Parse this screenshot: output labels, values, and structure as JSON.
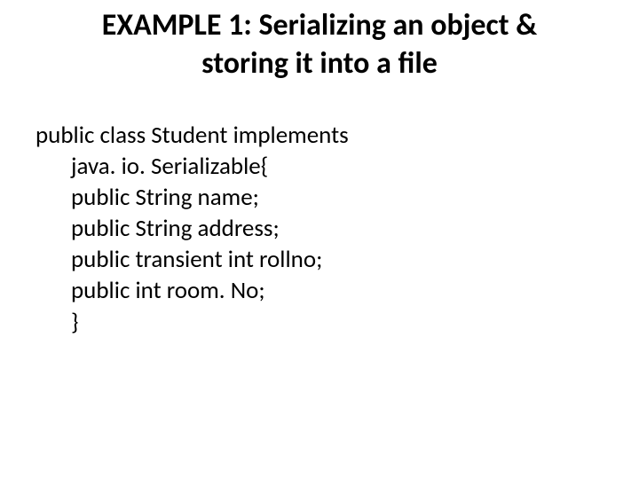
{
  "slide": {
    "title": "EXAMPLE 1: Serializing an object & storing it into a file",
    "code": {
      "line1": "public class Student implements",
      "line2": "java. io. Serializable{",
      "line3": "public String name;",
      "line4": "public String address;",
      "line5": "public transient int rollno;",
      "line6": "public int room. No;",
      "line7": "}"
    }
  }
}
